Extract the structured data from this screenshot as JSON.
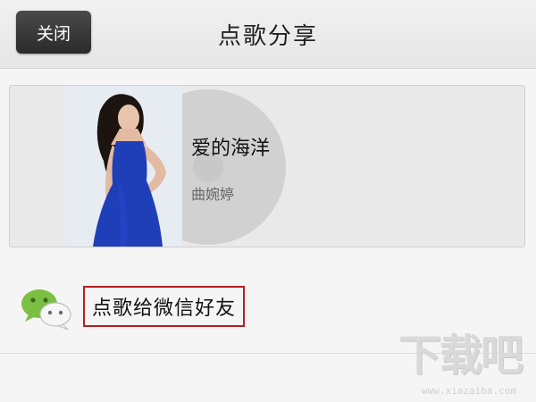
{
  "header": {
    "close_label": "关闭",
    "title": "点歌分享"
  },
  "song": {
    "title": "爱的海洋",
    "artist": "曲婉婷"
  },
  "share": {
    "label": "点歌给微信好友",
    "icon": "wechat-icon"
  },
  "watermark": {
    "text": "下载吧",
    "url": "www.xiazaiba.com"
  },
  "colors": {
    "highlight_border": "#b51f24",
    "dress_blue": "#1f3fb8"
  }
}
